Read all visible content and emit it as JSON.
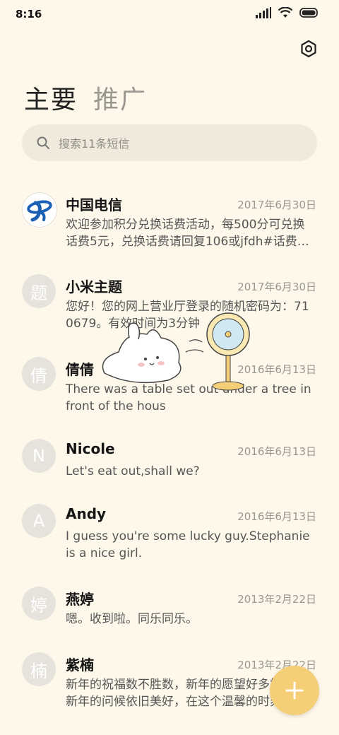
{
  "status_bar": {
    "time": "8:16"
  },
  "header": {
    "settings_icon": "gear-icon"
  },
  "tabs": [
    {
      "label": "主要",
      "active": true
    },
    {
      "label": "推广",
      "active": false
    }
  ],
  "search": {
    "placeholder": "搜索11条短信"
  },
  "conversations": [
    {
      "avatar_text": "",
      "avatar_icon": "china-telecom-logo",
      "name": "中国电信",
      "date": "2017年6月30日",
      "snippet": "欢迎参加积分兑换话费活动，每500分可兑换话费5元，兑换话费请回复106或jfdh#话费…"
    },
    {
      "avatar_text": "题",
      "name": "小米主题",
      "date": "2017年6月30日",
      "snippet": "您好！您的网上营业厅登录的随机密码为：710679。有效时间为3分钟"
    },
    {
      "avatar_text": "倩",
      "name": "倩倩",
      "date": "2016年6月13日",
      "snippet": "There was a table set out under a tree in front of the hous"
    },
    {
      "avatar_text": "N",
      "name": "Nicole",
      "date": "2016年6月13日",
      "snippet": "Let's eat out,shall we?"
    },
    {
      "avatar_text": "A",
      "name": "Andy",
      "date": "2016年6月13日",
      "snippet": "I guess you're some lucky guy.Stephanie is a nice girl."
    },
    {
      "avatar_text": "婷",
      "name": "燕婷",
      "date": "2013年2月22日",
      "snippet": "嗯。收到啦。同乐同乐。"
    },
    {
      "avatar_text": "楠",
      "name": "紫楠",
      "date": "2013年2月22日",
      "snippet": "新年的祝福数不胜数，新年的愿望好多好多，新年的问候依旧美好，在这个温馨的时刻"
    }
  ],
  "fab": {
    "icon": "plus-icon"
  },
  "colors": {
    "background": "#fdf8ea",
    "search_bg": "#efeadc",
    "avatar_bg": "#e6e3dc",
    "fab": "#f4cf78",
    "telecom_blue": "#1a5fb4"
  }
}
